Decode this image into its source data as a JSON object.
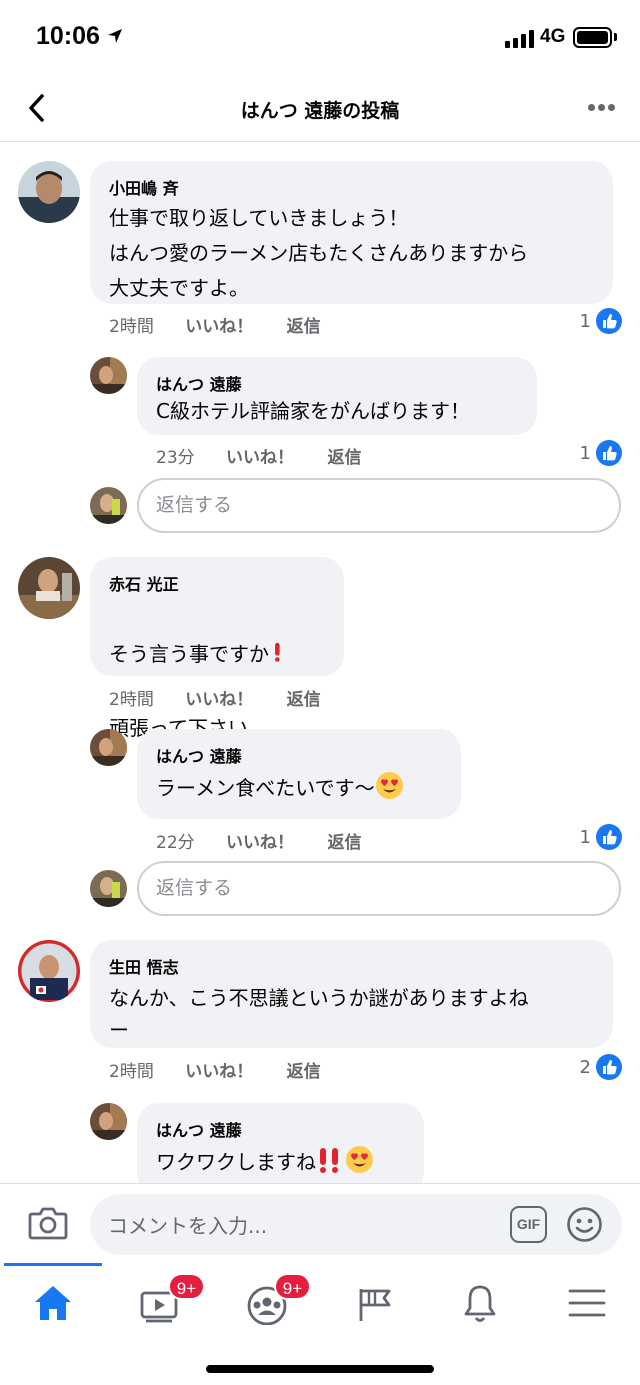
{
  "status_bar": {
    "time": "10:06",
    "network": "4G"
  },
  "header": {
    "title": "はんつ 遠藤の投稿"
  },
  "comments": [
    {
      "author": "小田嶋 斉",
      "text": "仕事で取り返していきましょう！\nはんつ愛のラーメン店もたくさんありますから\n大丈夫ですよ。",
      "time": "2時間",
      "like_label": "いいね！",
      "reply_label": "返信",
      "like_count": "1"
    },
    {
      "author": "はんつ 遠藤",
      "text": "C級ホテル評論家をがんばります！",
      "time": "23分",
      "like_label": "いいね！",
      "reply_label": "返信",
      "like_count": "1"
    },
    {
      "author": "赤石 光正",
      "text_line1": "そう言う事ですか",
      "text_line2": "頑張って下さい",
      "time": "2時間",
      "like_label": "いいね！",
      "reply_label": "返信"
    },
    {
      "author": "はんつ 遠藤",
      "text": "ラーメン食べたいです〜",
      "time": "22分",
      "like_label": "いいね！",
      "reply_label": "返信",
      "like_count": "1"
    },
    {
      "author": "生田 悟志",
      "text": "なんか、こう不思議というか謎がありますよね\nー",
      "time": "2時間",
      "like_label": "いいね！",
      "reply_label": "返信",
      "like_count": "2"
    },
    {
      "author": "はんつ 遠藤",
      "text": "ワクワクしますね"
    }
  ],
  "reply_inputs": {
    "placeholder": "返信する"
  },
  "composer": {
    "placeholder": "コメントを入力...",
    "gif_label": "GIF"
  },
  "tabs": {
    "watch_badge": "9+",
    "groups_badge": "9+"
  },
  "colors": {
    "accent": "#1877f2",
    "bubble": "#f0f2f5",
    "badge": "#e41e3f",
    "exclamation": "#e0242f"
  }
}
